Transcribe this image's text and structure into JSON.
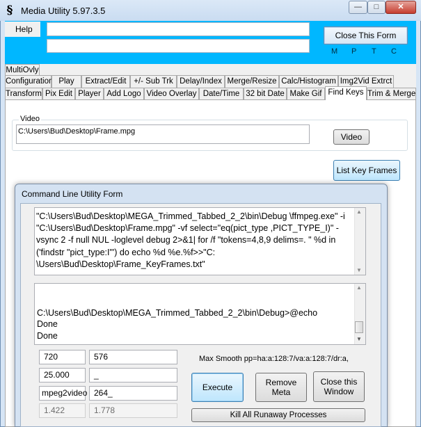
{
  "window": {
    "title": "Media Utility 5.97.3.5",
    "app_icon_glyph": "§"
  },
  "menu": {
    "help": "Help"
  },
  "header": {
    "text_field_1": "",
    "text_field_2": "",
    "close_form": "Close This Form",
    "letters": [
      "M",
      "P",
      "T",
      "C"
    ]
  },
  "tabs": {
    "row1": [
      "MultiOvly"
    ],
    "row2": [
      "Configuration",
      "Play",
      "Extract/Edit",
      "+/- Sub Trk",
      "Delay/Index",
      "Merge/Resize",
      "Calc/Histogram",
      "Img2Vid Extrct"
    ],
    "row3": [
      "Transform",
      "Pix Edit",
      "Player",
      "Add Logo",
      "Video Overlay",
      "Date/Time",
      "32 bit Date",
      "Make Gif",
      "Find Keys",
      "Trim & Merge"
    ],
    "selected": "Find Keys"
  },
  "video": {
    "legend": "Video",
    "path": "C:\\Users\\Bud\\Desktop\\Frame.mpg",
    "button": "Video"
  },
  "list_key_frames": "List Key Frames",
  "dialog": {
    "title": "Command Line Utility Form",
    "command": "\"C:\\Users\\Bud\\Desktop\\MEGA_Trimmed_Tabbed_2_2\\bin\\Debug \\ffmpeg.exe\" -i \"C:\\Users\\Bud\\Desktop\\Frame.mpg\" -vf select=\"eq(pict_type ,PICT_TYPE_I)\" -vsync 2 -f null NUL -loglevel debug 2>&1| for /f \"tokens=4,8,9 delims=. \" %d in ('findstr \"pict_type:I\"') do echo %d %e.%f>>\"C: \\Users\\Bud\\Desktop\\Frame_KeyFrames.txt\"",
    "output": "\nC:\\Users\\Bud\\Desktop\\MEGA_Trimmed_Tabbed_2_2\\bin\\Debug>@echo\nDone\nDone",
    "fields": {
      "width": "720",
      "height": "576",
      "fps": "25.000",
      "fps2": "_",
      "codec": "mpeg2video",
      "codec2": "264_",
      "ratio1": "1.422",
      "ratio2": "1.778"
    },
    "max_smooth": "Max Smooth pp=ha:a:128:7/va:a:128:7/dr:a,",
    "execute": "Execute",
    "remove_meta": "Remove Meta",
    "close_window": "Close this Window",
    "kill": "Kill All Runaway Processes"
  }
}
